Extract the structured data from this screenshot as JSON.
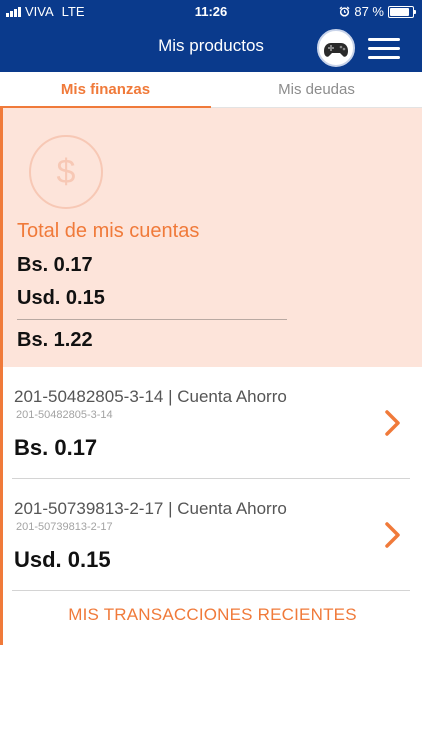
{
  "status_bar": {
    "carrier": "VIVA",
    "network": "LTE",
    "time": "11:26",
    "battery_percent": "87 %",
    "battery_level": 0.87
  },
  "nav": {
    "title": "Mis productos",
    "avatar_icon": "gamepad-icon",
    "menu_icon": "hamburger-menu-icon"
  },
  "tabs": [
    {
      "label": "Mis finanzas",
      "active": true
    },
    {
      "label": "Mis deudas",
      "active": false
    }
  ],
  "summary": {
    "icon": "dollar-circle-icon",
    "title": "Total de mis cuentas",
    "bs_line": "Bs. 0.17",
    "usd_line": "Usd. 0.15",
    "total": "Bs. 1.22"
  },
  "accounts": [
    {
      "title": "201-50482805-3-14 | Cuenta Ahorro",
      "subtitle": "201-50482805-3-14",
      "balance": "Bs. 0.17"
    },
    {
      "title": "201-50739813-2-17 | Cuenta Ahorro",
      "subtitle": "201-50739813-2-17",
      "balance": "Usd. 0.15"
    }
  ],
  "transactions_link": "MIS TRANSACCIONES RECIENTES",
  "colors": {
    "header_bg": "#0a3a8c",
    "accent": "#f07a3a",
    "summary_bg": "#fde4da"
  }
}
